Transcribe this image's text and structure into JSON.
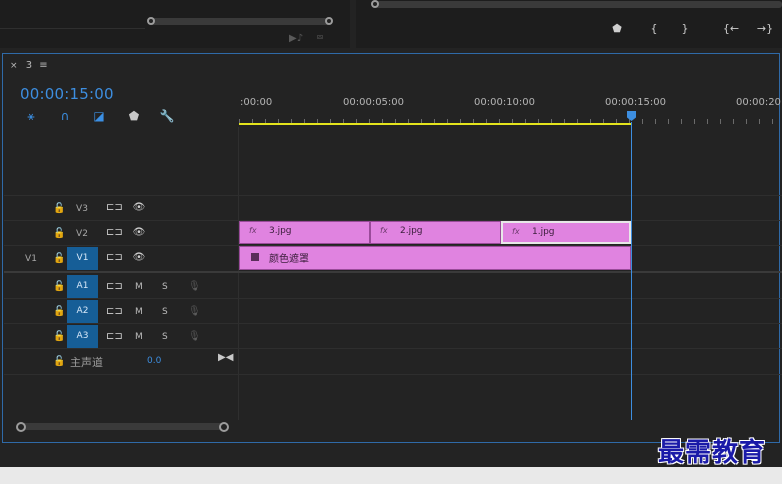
{
  "sequence": {
    "tab_number": "3",
    "menu_icon": "hamburger-icon",
    "close_icon": "close-icon",
    "timecode": "00:00:15:00"
  },
  "program_controls": [
    "add-marker-icon",
    "mark-in-icon",
    "mark-out-icon",
    "go-to-in-icon",
    "go-to-out-icon"
  ],
  "tools": [
    "insert-icon",
    "snap-icon",
    "linked-selection-icon",
    "marker-icon",
    "wrench-icon"
  ],
  "ruler": {
    "labels": [
      ":00:00",
      "00:00:05:00",
      "00:00:10:00",
      "00:00:15:00",
      "00:00:20:"
    ]
  },
  "tracks": {
    "video": [
      {
        "name": "V3",
        "source": ""
      },
      {
        "name": "V2",
        "source": ""
      },
      {
        "name": "V1",
        "source": "V1",
        "targeted": true
      }
    ],
    "audio": [
      {
        "name": "A1",
        "m": "M",
        "s": "S"
      },
      {
        "name": "A2",
        "m": "M",
        "s": "S"
      },
      {
        "name": "A3",
        "m": "M",
        "s": "S"
      }
    ],
    "master": {
      "label": "主声道",
      "value": "0.0"
    }
  },
  "clips": {
    "v2": [
      {
        "name": "3.jpg",
        "fx": "fx"
      },
      {
        "name": "2.jpg",
        "fx": "fx"
      },
      {
        "name": "1.jpg",
        "fx": "fx"
      }
    ],
    "v1": {
      "name": "颜色遮罩"
    }
  },
  "colors": {
    "accent": "#3d8ee0",
    "clip": "#e083e0",
    "track_target": "#165e97",
    "work_area": "#e4e41c"
  },
  "watermark": "最需教育"
}
